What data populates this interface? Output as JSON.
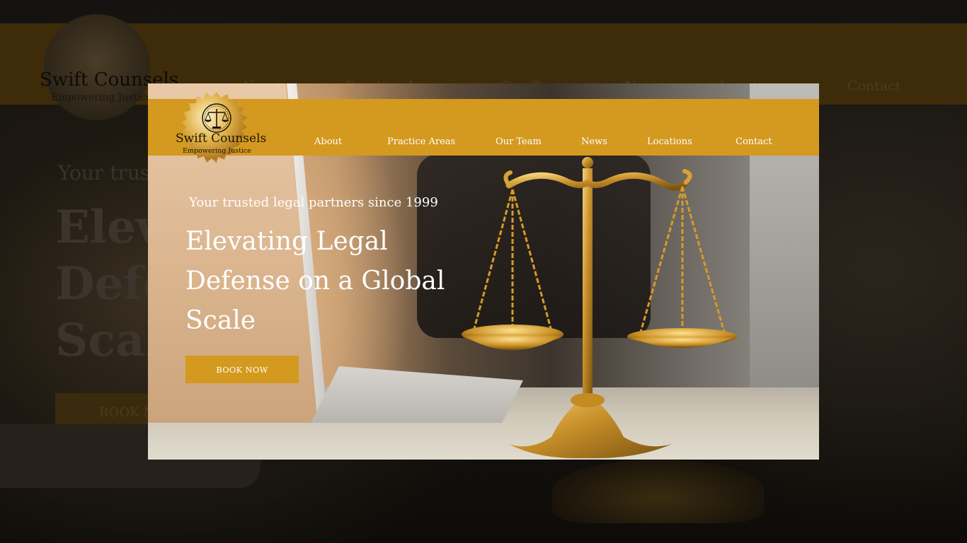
{
  "brand": {
    "name": "Swift Counsels",
    "tagline": "Empowering Justice"
  },
  "nav": {
    "items": [
      {
        "label": "About"
      },
      {
        "label": "Practice Areas"
      },
      {
        "label": "Our Team"
      },
      {
        "label": "News"
      },
      {
        "label": "Locations"
      },
      {
        "label": "Contact"
      }
    ]
  },
  "hero": {
    "tagline": "Your trusted legal partners since 1999",
    "headline": "Elevating Legal Defense on a Global Scale",
    "book_label": "BOOK NOW"
  },
  "backdrop": {
    "tagline_partial": "Your trus",
    "headline_partial": "Eleva Defe Scale",
    "book_partial": "BOOK N"
  },
  "colors": {
    "accent": "#d4991f",
    "text_on_accent": "#ffffff",
    "brand_text": "#1a1409"
  },
  "icons": {
    "logo": "scales-of-justice-icon"
  }
}
